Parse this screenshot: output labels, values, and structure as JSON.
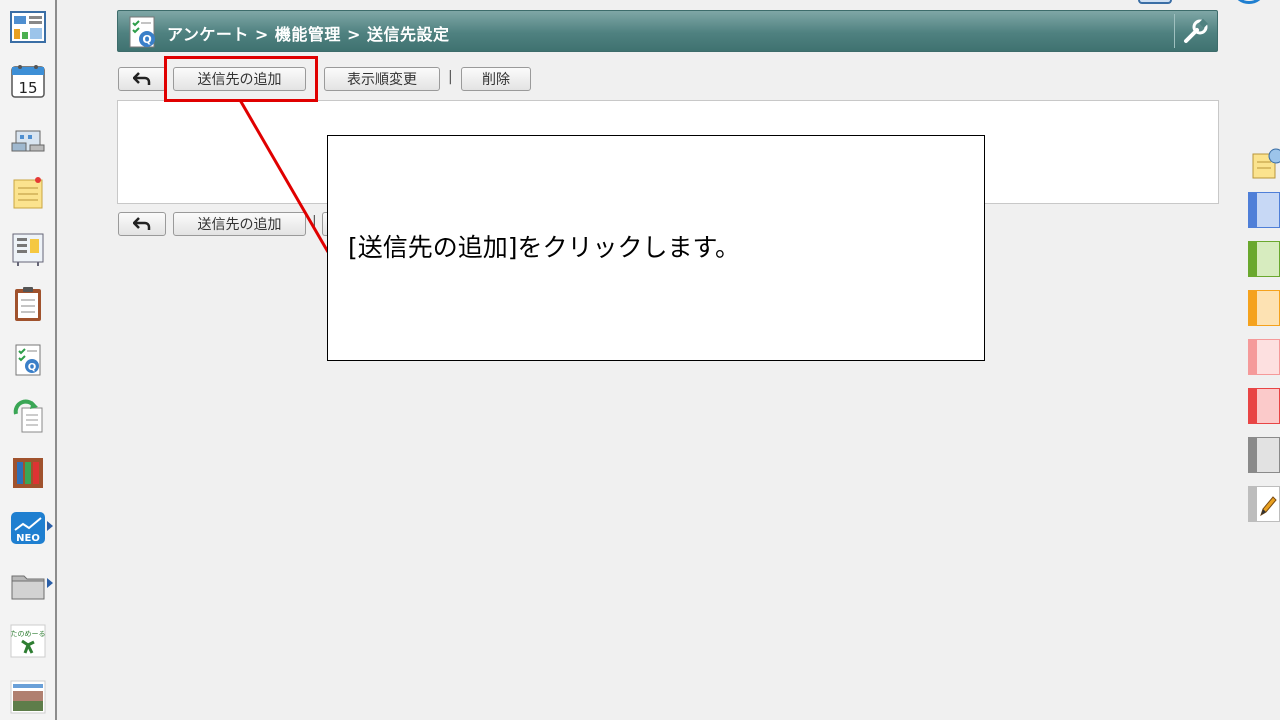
{
  "header": {
    "title": "アンケート > 機能管理 > 送信先設定"
  },
  "toolbar_top": {
    "back_icon": "back-arrow-icon",
    "add_label": "送信先の追加",
    "order_label": "表示順変更",
    "separator": "|",
    "delete_label": "削除"
  },
  "toolbar_bottom": {
    "back_icon": "back-arrow-icon",
    "add_label": "送信先の追加",
    "separator": "|"
  },
  "callout": {
    "text": "[送信先の追加]をクリックします。"
  },
  "sidebar": {
    "items": [
      {
        "icon": "portal-icon"
      },
      {
        "icon": "calendar-icon",
        "label": "15"
      },
      {
        "icon": "facility-icon"
      },
      {
        "icon": "memo-icon"
      },
      {
        "icon": "bulletin-board-icon"
      },
      {
        "icon": "clipboard-icon"
      },
      {
        "icon": "survey-icon"
      },
      {
        "icon": "circular-icon"
      },
      {
        "icon": "binder-icon"
      },
      {
        "icon": "neo-icon",
        "label": "NEO"
      },
      {
        "icon": "folder-icon"
      },
      {
        "icon": "tanomail-icon",
        "label": "たのめーる"
      },
      {
        "icon": "banner-icon"
      }
    ]
  },
  "right_tabs": {
    "colors": [
      "#4f7fd8",
      "#6aa82e",
      "#f5a21d",
      "#f59a9a",
      "#e84545",
      "#8a8a8a"
    ]
  },
  "colors": {
    "header_bg": "#4f8180",
    "highlight": "#e00000"
  }
}
